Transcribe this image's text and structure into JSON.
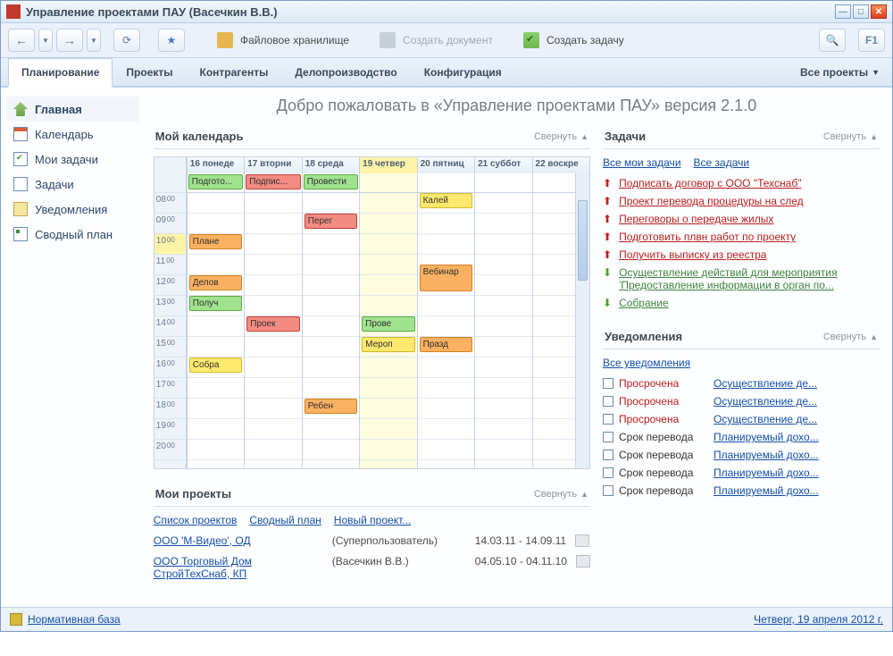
{
  "window": {
    "title": "Управление проектами ПАУ (Васечкин В.В.)"
  },
  "toolbar": {
    "file_storage": "Файловое хранилище",
    "create_doc": "Создать документ",
    "create_task": "Создать задачу"
  },
  "tabs": {
    "planning": "Планирование",
    "projects": "Проекты",
    "contractors": "Контрагенты",
    "docs": "Делопроизводство",
    "config": "Конфигурация",
    "all_projects": "Все проекты"
  },
  "sidebar": {
    "home": "Главная",
    "calendar": "Календарь",
    "my_tasks": "Мои задачи",
    "tasks": "Задачи",
    "notifications": "Уведомления",
    "summary": "Сводный план"
  },
  "welcome": "Добро пожаловать в «Управление проектами ПАУ» версия 2.1.0",
  "collapse": "Свернуть",
  "calendar_panel": {
    "title": "Мой календарь",
    "day_headers": [
      "16 понеде",
      "17 вторни",
      "18 среда",
      "19 четвер",
      "20 пятниц",
      "21 суббот",
      "22 воскре"
    ],
    "hours": [
      "08",
      "09",
      "10",
      "11",
      "12",
      "13",
      "14",
      "15",
      "16",
      "17",
      "18",
      "19",
      "20"
    ],
    "allday_16": "Подгото...",
    "allday_17": "Подпис...",
    "allday_18": "Провести",
    "ev_plane": "Плане",
    "ev_delov": "Делов",
    "ev_poluch": "Получ",
    "ev_sobra": "Собра",
    "ev_proek": "Проек",
    "ev_pereg": "Перег",
    "ev_reben": "Ребен",
    "ev_prove": "Прове",
    "ev_merop": "Мероп",
    "ev_kalei": "Калей",
    "ev_vebinar": "Вебинар",
    "ev_prazd": "Празд"
  },
  "projects_panel": {
    "title": "Мои проекты",
    "link_list": "Список проектов",
    "link_summary": "Сводный план",
    "link_new": "Новый проект...",
    "rows": [
      {
        "name": "ООО 'М-Видео', ОД",
        "owner": "(Суперпользователь)",
        "dates": "14.03.11 - 14.09.11"
      },
      {
        "name": "ООО Торговый Дом СтройТехСнаб, КП",
        "owner": "(Васечкин В.В.)",
        "dates": "04.05.10 - 04.11.10"
      }
    ]
  },
  "tasks_panel": {
    "title": "Задачи",
    "link_my": "Все мои задачи",
    "link_all": "Все задачи",
    "items": [
      {
        "pri": "up",
        "text": "Подписать договор с ООО \"Техснаб\""
      },
      {
        "pri": "up",
        "text": "Проект перевода процедуры на след"
      },
      {
        "pri": "up",
        "text": "Переговоры о передаче жилых"
      },
      {
        "pri": "up",
        "text": "Подготовить плвн работ по проекту"
      },
      {
        "pri": "up",
        "text": "Получить выписку из реестра"
      },
      {
        "pri": "down",
        "text": "Осуществление действий для мероприятия 'Предоставление информации в орган по..."
      },
      {
        "pri": "down",
        "text": "Собрание"
      }
    ]
  },
  "notifications_panel": {
    "title": "Уведомления",
    "link_all": "Все уведомления",
    "items": [
      {
        "status": "Просрочена",
        "red": true,
        "desc": "Осуществление де..."
      },
      {
        "status": "Просрочена",
        "red": true,
        "desc": "Осуществление де..."
      },
      {
        "status": "Просрочена",
        "red": true,
        "desc": "Осуществление де..."
      },
      {
        "status": "Срок перевода",
        "red": false,
        "desc": "Планируемый дохо..."
      },
      {
        "status": "Срок перевода",
        "red": false,
        "desc": "Планируемый дохо..."
      },
      {
        "status": "Срок перевода",
        "red": false,
        "desc": "Планируемый дохо..."
      },
      {
        "status": "Срок перевода",
        "red": false,
        "desc": "Планируемый дохо..."
      }
    ]
  },
  "statusbar": {
    "normative": "Нормативная база",
    "date": "Четверг, 19 апреля 2012 г."
  }
}
